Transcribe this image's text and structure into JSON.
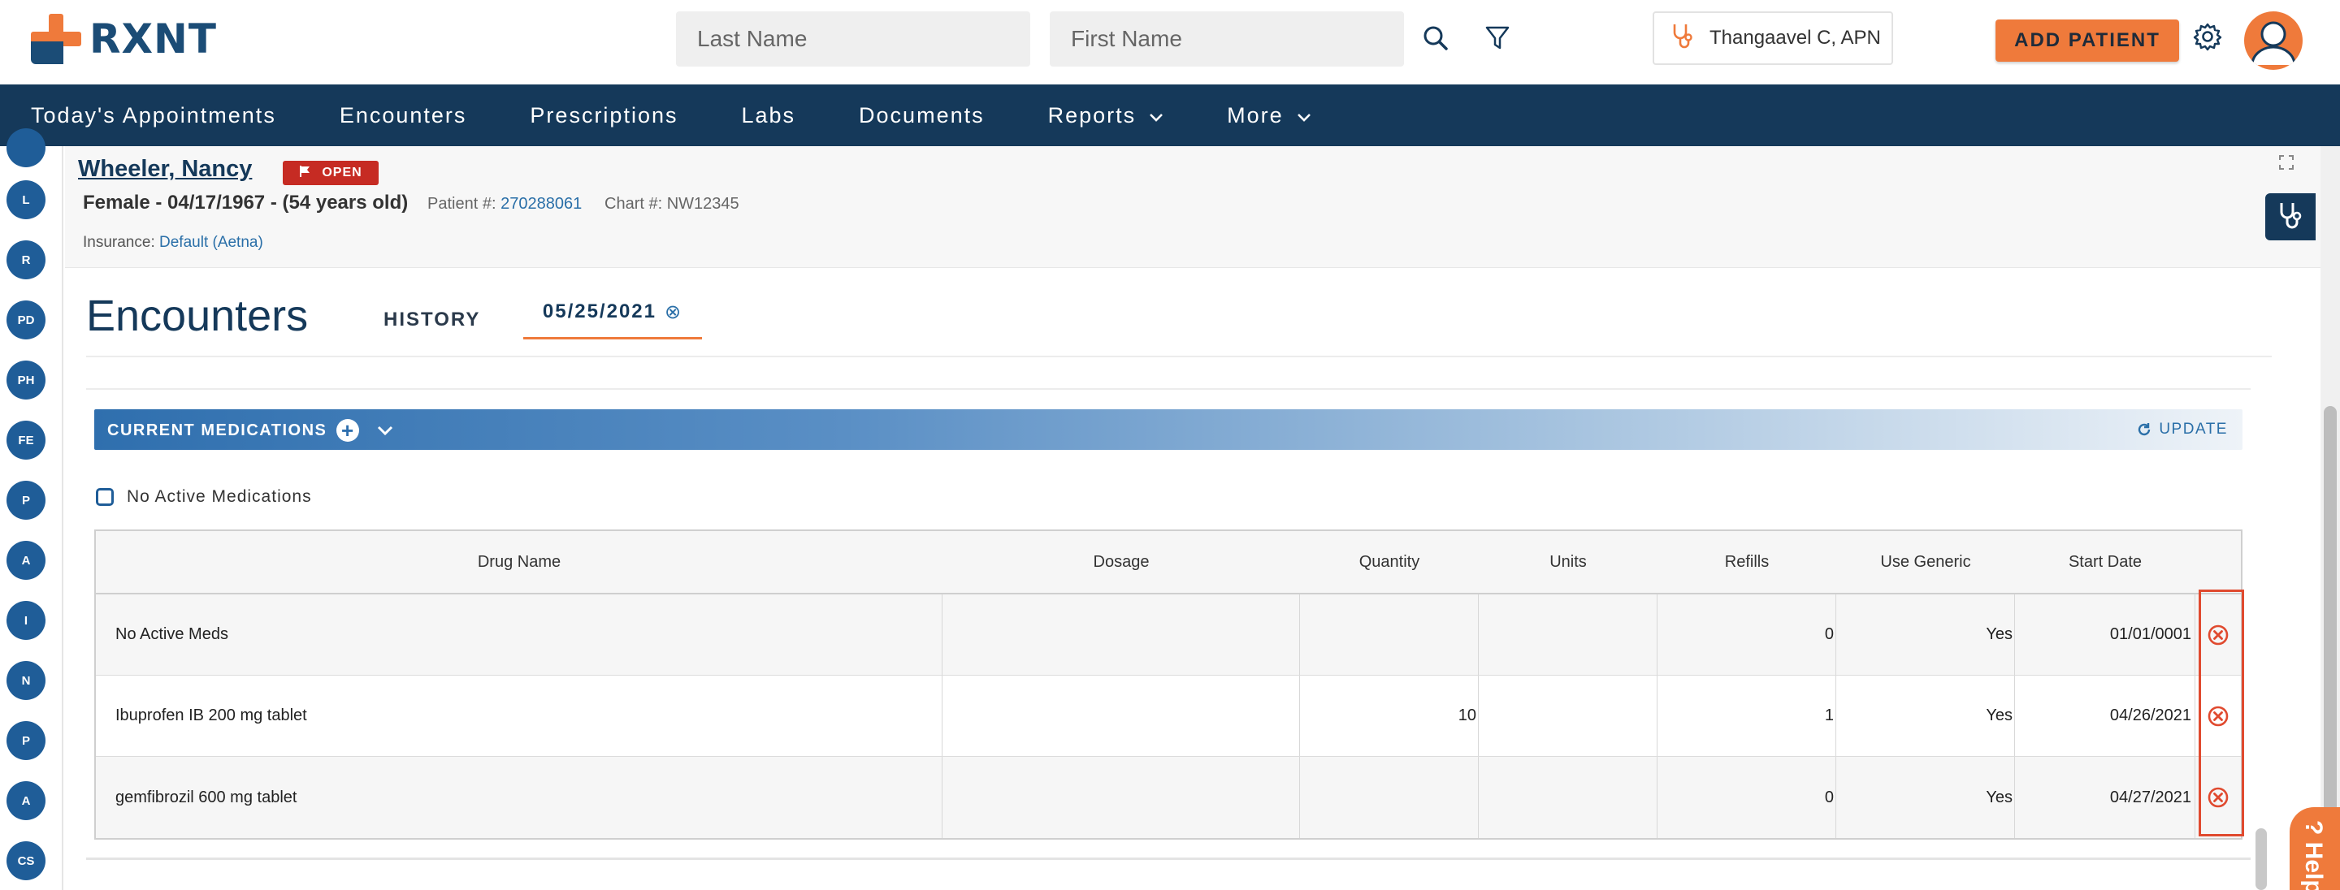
{
  "header": {
    "logo_text": "RXNT",
    "last_name_placeholder": "Last Name",
    "first_name_placeholder": "First Name",
    "provider": "Thangaavel C, APN",
    "add_patient_label": "ADD PATIENT"
  },
  "nav": {
    "items": [
      "Today's Appointments",
      "Encounters",
      "Prescriptions",
      "Labs",
      "Documents",
      "Reports",
      "More"
    ]
  },
  "rail": {
    "items": [
      "L",
      "R",
      "PD",
      "PH",
      "FE",
      "P",
      "A",
      "I",
      "N",
      "P",
      "A",
      "CS"
    ]
  },
  "patient": {
    "name": "Wheeler, Nancy",
    "status": "OPEN",
    "demographics": "Female - 04/17/1967 - (54 years old)",
    "patient_no_label": "Patient #:",
    "patient_no": "270288061",
    "chart_no_label": "Chart #:",
    "chart_no": "NW12345",
    "insurance_label": "Insurance:",
    "insurance": "Default (Aetna)"
  },
  "encounters": {
    "title": "Encounters",
    "tab_history": "HISTORY",
    "tab_date": "05/25/2021",
    "tab_close_glyph": "⊗"
  },
  "medications": {
    "section_title": "CURRENT MEDICATIONS",
    "update_label": "UPDATE",
    "no_active_label": "No Active Medications",
    "no_active_checked": false,
    "columns": [
      "Drug Name",
      "Dosage",
      "Quantity",
      "Units",
      "Refills",
      "Use Generic",
      "Start Date"
    ],
    "rows": [
      {
        "drug": "No Active Meds",
        "dosage": "",
        "quantity": "",
        "units": "",
        "refills": "0",
        "generic": "Yes",
        "start": "01/01/0001"
      },
      {
        "drug": "Ibuprofen IB 200 mg tablet",
        "dosage": "",
        "quantity": "10",
        "units": "",
        "refills": "1",
        "generic": "Yes",
        "start": "04/26/2021"
      },
      {
        "drug": "gemfibrozil 600 mg tablet",
        "dosage": "",
        "quantity": "",
        "units": "",
        "refills": "0",
        "generic": "Yes",
        "start": "04/27/2021"
      }
    ]
  },
  "help": {
    "label": "? Help"
  },
  "colors": {
    "brand_navy": "#15395a",
    "brand_orange": "#ef7a3b",
    "badge_red": "#c62b23",
    "link_blue": "#2a6fa8",
    "delete_red": "#e04a2f"
  }
}
